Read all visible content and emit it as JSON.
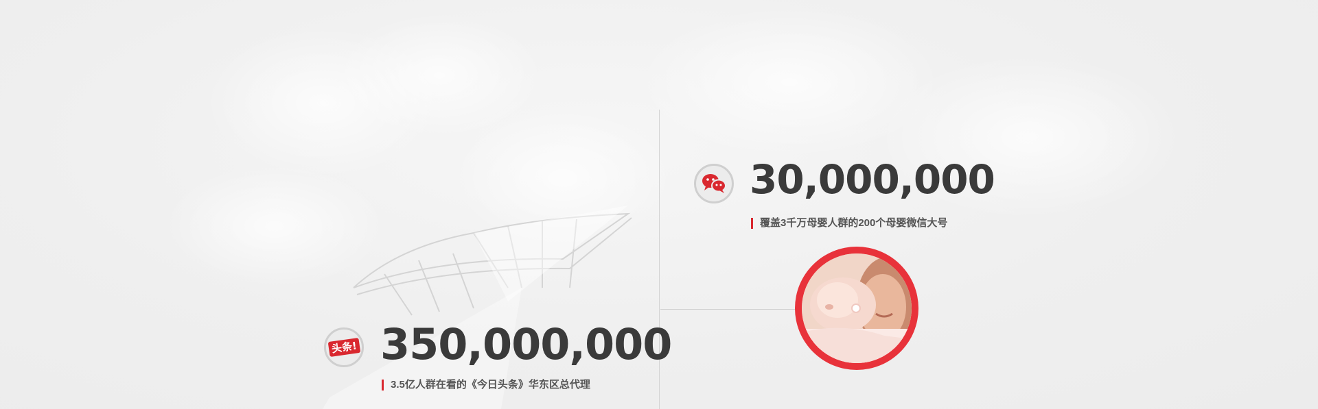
{
  "stats": [
    {
      "id": "toutiao",
      "icon": "toutiao-logo-icon",
      "icon_label": "头条!",
      "number": "350,000,000",
      "description": "3.5亿人群在看的《今日头条》华东区总代理"
    },
    {
      "id": "wechat",
      "icon": "wechat-icon",
      "number": "30,000,000",
      "description": "覆盖3千万母婴人群的200个母婴微信大号"
    }
  ],
  "colors": {
    "accent": "#d9282f",
    "ring": "#e8323a",
    "text_dark": "#3a3a3a",
    "text_desc": "#555555",
    "background": "#efefef"
  }
}
